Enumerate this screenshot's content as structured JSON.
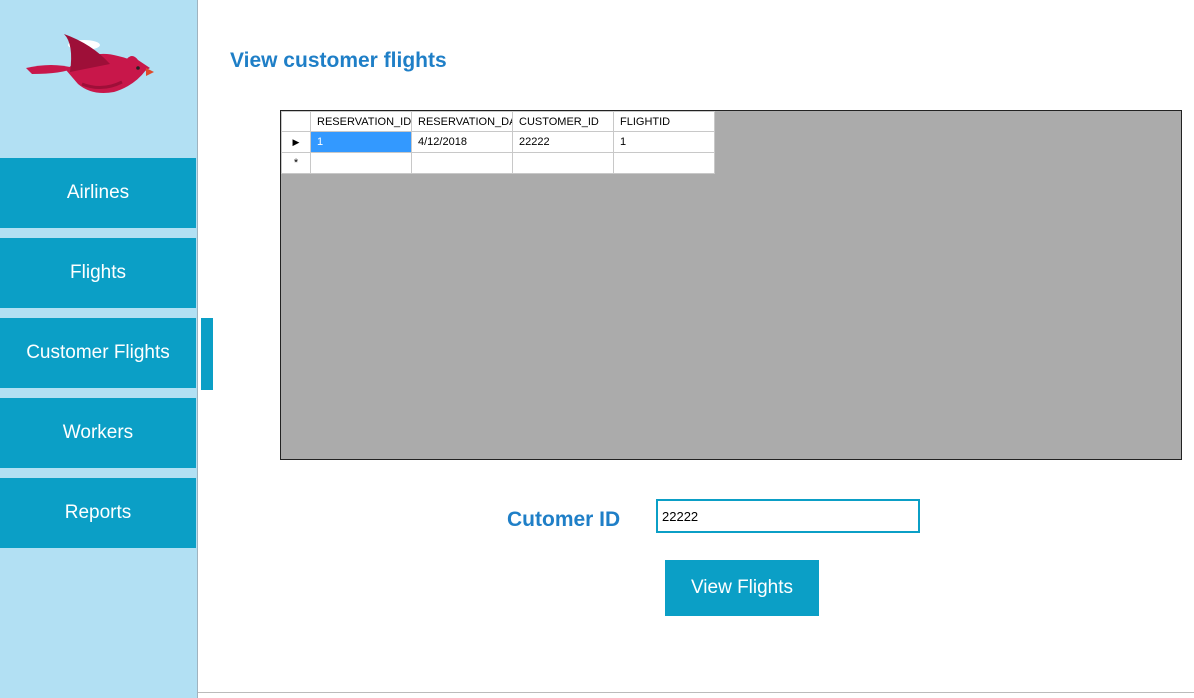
{
  "page": {
    "title": "View customer flights"
  },
  "sidebar": {
    "logo_icon": "cardinal-bird-logo",
    "items": [
      {
        "label": "Airlines"
      },
      {
        "label": "Flights"
      },
      {
        "label": "Customer Flights",
        "active": true
      },
      {
        "label": "Workers"
      },
      {
        "label": "Reports"
      }
    ]
  },
  "grid": {
    "columns": [
      "RESERVATION_ID",
      "RESERVATION_DAT",
      "CUSTOMER_ID",
      "FLIGHTID"
    ],
    "rows": [
      {
        "marker": "▶",
        "cells": [
          "1",
          "4/12/2018",
          "22222",
          "1"
        ]
      }
    ],
    "new_row_marker": "*"
  },
  "form": {
    "customer_id_label": "Cutomer ID",
    "customer_id_value": "22222",
    "view_button_label": "View Flights"
  },
  "colors": {
    "sidebar_bg": "#b2e0f3",
    "accent": "#0b9fc6",
    "title": "#1f7fc7",
    "grid_bg": "#ababab",
    "selection": "#3399ff"
  }
}
